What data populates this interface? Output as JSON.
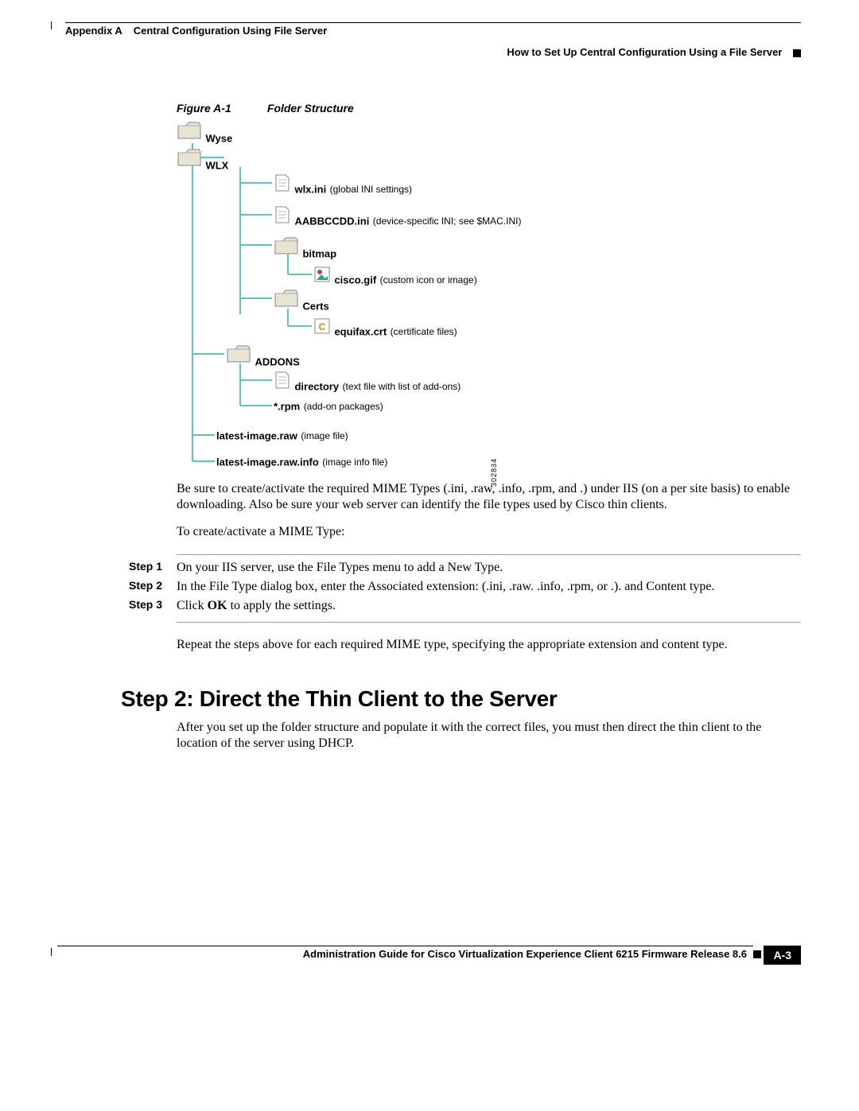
{
  "header": {
    "appendix": "Appendix A",
    "chapter": "Central Configuration Using File Server",
    "subtitle": "How to Set Up Central Configuration Using a File Server"
  },
  "figure": {
    "label": "Figure A-1",
    "title": "Folder Structure",
    "id_number": "302834"
  },
  "tree": {
    "wyse": "Wyse",
    "wlx": "WLX",
    "wlx_ini": "wlx.ini",
    "wlx_ini_note": "(global INI settings)",
    "mac_ini": "AABBCCDD.ini",
    "mac_ini_note": "(device-specific INI; see $MAC.INI)",
    "bitmap": "bitmap",
    "cisco_gif": "cisco.gif",
    "cisco_gif_note": "(custom icon or image)",
    "certs": "Certs",
    "equifax": "equifax.crt",
    "equifax_note": "(certificate files)",
    "addons": "ADDONS",
    "directory": "directory",
    "directory_note": "(text file with list of add-ons)",
    "rpm": "*.rpm",
    "rpm_note": "(add-on packages)",
    "latest_raw": "latest-image.raw",
    "latest_raw_note": "(image file)",
    "latest_info": "latest-image.raw.info",
    "latest_info_note": "(image info file)"
  },
  "body": {
    "para1": "Be sure to create/activate the required MIME Types (.ini, .raw, .info, .rpm, and .) under IIS (on a per site basis) to enable downloading. Also be sure your web server can identify the file types used by Cisco thin clients.",
    "para2": "To create/activate a MIME Type:",
    "para3": "Repeat the steps above for each required MIME type, specifying the appropriate extension and content type."
  },
  "steps": [
    {
      "num": "Step 1",
      "text": "On your IIS server, use the File Types menu to add a New Type."
    },
    {
      "num": "Step 2",
      "text": "In the File Type dialog box, enter the Associated extension: (.ini, .raw. .info, .rpm, or .). and Content type."
    },
    {
      "num": "Step 3",
      "text_pre": "Click ",
      "bold": "OK",
      "text_post": " to apply the settings."
    }
  ],
  "section": {
    "heading": "Step 2: Direct the Thin Client to the Server",
    "para": "After you set up the folder structure and populate it with the correct files, you must then direct the thin client to the location of the server using DHCP."
  },
  "footer": {
    "title": "Administration Guide for Cisco Virtualization Experience Client 6215 Firmware Release 8.6",
    "page": "A-3"
  }
}
